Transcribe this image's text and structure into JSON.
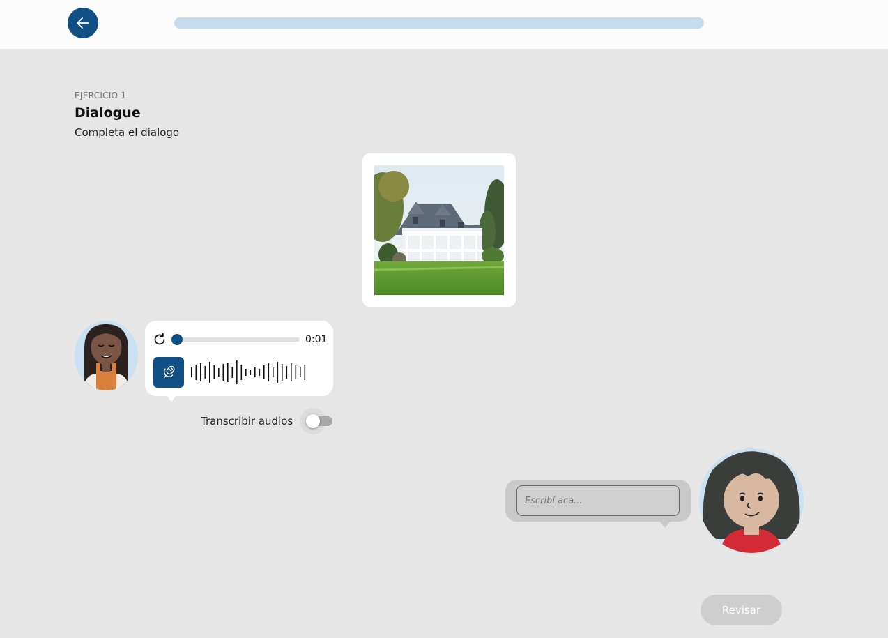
{
  "header": {
    "back_icon": "arrow-left-icon",
    "progress": 0,
    "colors": {
      "accent": "#0f4f83",
      "progress_track": "#c5dcec"
    }
  },
  "exercise": {
    "label": "EJERCICIO 1",
    "title": "Dialogue",
    "instructions": "Completa el dialogo"
  },
  "prompt_image": {
    "subject": "house-photo"
  },
  "audio_message": {
    "replay_icon": "replay-icon",
    "mic_icon": "microphone-icon",
    "time": "0:01",
    "playback_position": 0.03
  },
  "transcribe": {
    "label": "Transcribir audios",
    "enabled": false
  },
  "answer": {
    "placeholder": "Escribí aca...",
    "value": ""
  },
  "actions": {
    "review_label": "Revisar"
  }
}
